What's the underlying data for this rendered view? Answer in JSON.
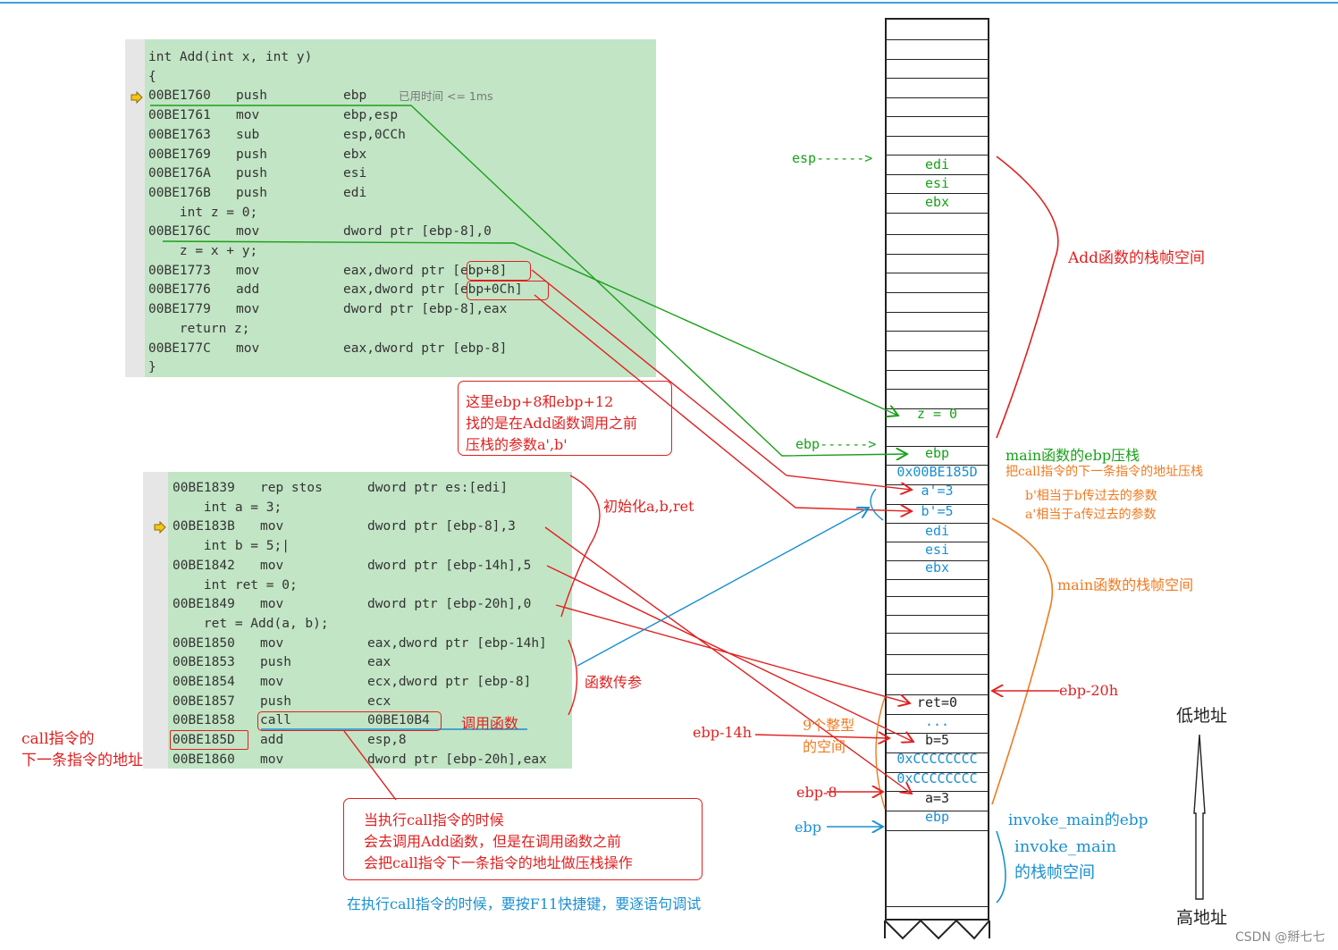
{
  "colors": {
    "code_bg": "#c2e5c5",
    "red": "#e02020",
    "green": "#1aa01a",
    "blue": "#1a8fd0",
    "orange": "#f07a20",
    "dark": "#222222"
  },
  "add_code": [
    {
      "addr": "int Add(int x, int y)",
      "mn": "",
      "op": ""
    },
    {
      "addr": "{",
      "mn": "",
      "op": ""
    },
    {
      "addr": "00BE1760",
      "mn": "push",
      "op": "ebp"
    },
    {
      "addr": "00BE1761",
      "mn": "mov",
      "op": "ebp,esp"
    },
    {
      "addr": "00BE1763",
      "mn": "sub",
      "op": "esp,0CCh"
    },
    {
      "addr": "00BE1769",
      "mn": "push",
      "op": "ebx"
    },
    {
      "addr": "00BE176A",
      "mn": "push",
      "op": "esi"
    },
    {
      "addr": "00BE176B",
      "mn": "push",
      "op": "edi"
    },
    {
      "addr": "    int z = 0;",
      "mn": "",
      "op": ""
    },
    {
      "addr": "00BE176C",
      "mn": "mov",
      "op": "dword ptr [ebp-8],0"
    },
    {
      "addr": "    z = x + y;",
      "mn": "",
      "op": ""
    },
    {
      "addr": "00BE1773",
      "mn": "mov",
      "op": "eax,dword ptr [ebp+8]"
    },
    {
      "addr": "00BE1776",
      "mn": "add",
      "op": "eax,dword ptr [ebp+0Ch]"
    },
    {
      "addr": "00BE1779",
      "mn": "mov",
      "op": "dword ptr [ebp-8],eax"
    },
    {
      "addr": "    return z;",
      "mn": "",
      "op": ""
    },
    {
      "addr": "00BE177C",
      "mn": "mov",
      "op": "eax,dword ptr [ebp-8]"
    },
    {
      "addr": "}",
      "mn": "",
      "op": ""
    }
  ],
  "elapsed_hint": "已用时间 <= 1ms",
  "main_code": [
    {
      "addr": "00BE1839",
      "mn": "rep stos",
      "op": "dword ptr es:[edi]"
    },
    {
      "addr": "    int a = 3;",
      "mn": "",
      "op": ""
    },
    {
      "addr": "00BE183B",
      "mn": "mov",
      "op": "dword ptr [ebp-8],3"
    },
    {
      "addr": "    int b = 5;|",
      "mn": "",
      "op": ""
    },
    {
      "addr": "00BE1842",
      "mn": "mov",
      "op": "dword ptr [ebp-14h],5"
    },
    {
      "addr": "    int ret = 0;",
      "mn": "",
      "op": ""
    },
    {
      "addr": "00BE1849",
      "mn": "mov",
      "op": "dword ptr [ebp-20h],0"
    },
    {
      "addr": "    ret = Add(a, b);",
      "mn": "",
      "op": ""
    },
    {
      "addr": "00BE1850",
      "mn": "mov",
      "op": "eax,dword ptr [ebp-14h]"
    },
    {
      "addr": "00BE1853",
      "mn": "push",
      "op": "eax"
    },
    {
      "addr": "00BE1854",
      "mn": "mov",
      "op": "ecx,dword ptr [ebp-8]"
    },
    {
      "addr": "00BE1857",
      "mn": "push",
      "op": "ecx"
    },
    {
      "addr": "00BE1858",
      "mn": "call",
      "op": "00BE10B4"
    },
    {
      "addr": "00BE185D",
      "mn": "add",
      "op": "esp,8"
    },
    {
      "addr": "00BE1860",
      "mn": "mov",
      "op": "dword ptr [ebp-20h],eax"
    }
  ],
  "stack_slots": [
    {
      "text": "edi",
      "color": "green"
    },
    {
      "text": "esi",
      "color": "green"
    },
    {
      "text": "ebx",
      "color": "green"
    },
    {
      "text": "z = 0",
      "color": "green"
    },
    {
      "text": "ebp",
      "color": "green"
    },
    {
      "text": "0x00BE185D",
      "color": "blue"
    },
    {
      "text": "a'=3",
      "color": "blue"
    },
    {
      "text": "b'=5",
      "color": "blue"
    },
    {
      "text": "edi",
      "color": "blue"
    },
    {
      "text": "esi",
      "color": "blue"
    },
    {
      "text": "ebx",
      "color": "blue"
    },
    {
      "text": "ret=0",
      "color": "dark"
    },
    {
      "text": "...",
      "color": "blue"
    },
    {
      "text": "b=5",
      "color": "dark"
    },
    {
      "text": "0xCCCCCCCC",
      "color": "blue"
    },
    {
      "text": "0xCCCCCCCC",
      "color": "blue"
    },
    {
      "text": "a=3",
      "color": "dark"
    },
    {
      "text": "ebp",
      "color": "blue"
    }
  ],
  "labels": {
    "esp_ptr": "esp------>",
    "ebp_ptr": "ebp------>",
    "add_frame": "Add函数的栈帧空间",
    "main_ebp_push": "main函数的ebp压栈",
    "push_next_addr": "把call指令的下一条指令的地址压栈",
    "b_param": "b'相当于b传过去的参数",
    "a_param": "a'相当于a传过去的参数",
    "main_frame": "main函数的栈帧空间",
    "ebp_20h": "ebp-20h",
    "ebp_14h": "ebp-14h",
    "nine_ints_1": "9个整型",
    "nine_ints_2": "的空间",
    "ebp_8": "ebp-8",
    "ebp": "ebp",
    "invoke_ebp": "invoke_main的ebp",
    "invoke_frame_1": "invoke_main",
    "invoke_frame_2": "的栈帧空间",
    "low_addr": "低地址",
    "high_addr": "高地址",
    "init_abret": "初始化a,b,ret",
    "pass_params": "函数传参",
    "call_func": "调用函数",
    "call_next_1": "call指令的",
    "call_next_2": "下一条指令的地址",
    "note1_1": "这里ebp+8和ebp+12",
    "note1_2": "找的是在Add函数调用之前",
    "note1_3": "压栈的参数a',b'",
    "note2_1": "当执行call指令的时候",
    "note2_2": "会去调用Add函数，但是在调用函数之前",
    "note2_3": "会把call指令下一条指令的地址做压栈操作",
    "f11_note": "在执行call指令的时候，要按F11快捷键，要逐语句调试",
    "watermark": "CSDN @掰七七"
  }
}
